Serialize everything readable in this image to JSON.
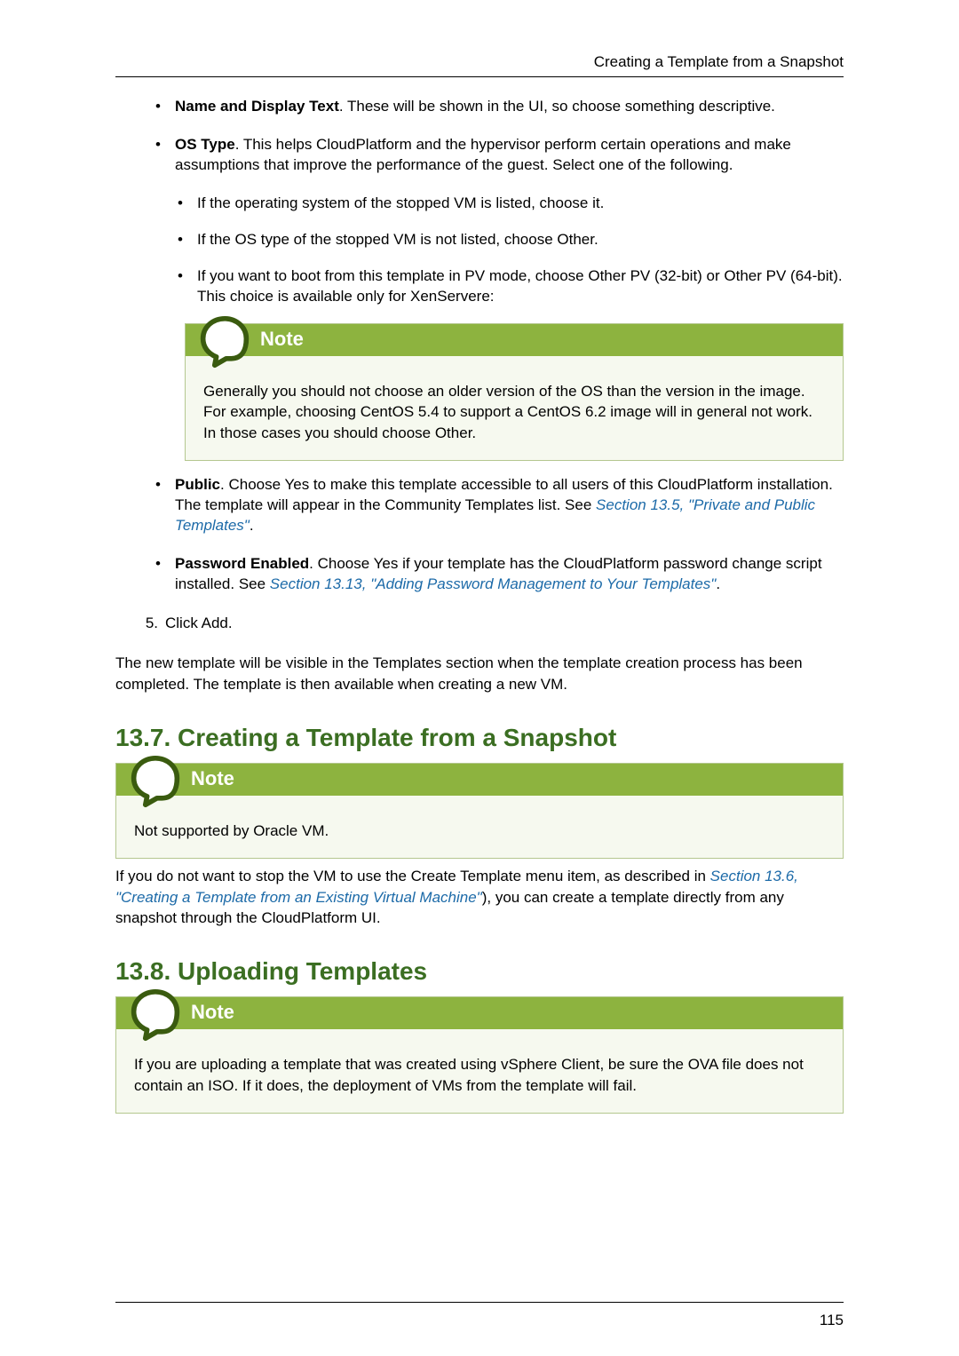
{
  "header": {
    "running_title": "Creating a Template from a Snapshot"
  },
  "bullets": {
    "name_display": {
      "label": "Name and Display Text",
      "text": ". These will be shown in the UI, so choose something descriptive."
    },
    "os_type": {
      "label": "OS Type",
      "text": ". This helps CloudPlatform and the hypervisor perform certain operations and make assumptions that improve the performance of the guest. Select one of the following."
    },
    "os_sub1": "If the operating system of the stopped VM is listed, choose it.",
    "os_sub2": "If the OS type of the stopped VM is not listed, choose Other.",
    "os_sub3": "If you want to boot from this template in PV mode, choose Other PV (32-bit) or Other PV (64-bit). This choice is available only for XenServere:",
    "public": {
      "label": "Public",
      "text1": ". Choose Yes to make this template accessible to all users of this CloudPlatform installation. The template will appear in the Community Templates list. See ",
      "link": "Section 13.5, \"Private and Public Templates\"",
      "text2": "."
    },
    "password_enabled": {
      "label": "Password Enabled",
      "text1": ". Choose Yes if your template has the CloudPlatform password change script installed. See ",
      "link": "Section 13.13, \"Adding Password Management to Your Templates\"",
      "text2": "."
    }
  },
  "note1": {
    "title": "Note",
    "body": "Generally you should not choose an older version of the OS than the version in the image. For example, choosing CentOS 5.4 to support a CentOS 6.2 image will in general not work. In those cases you should choose Other."
  },
  "step5": {
    "num": "5.",
    "text": "Click Add."
  },
  "after_steps_para": "The new template will be visible in the Templates section when the template creation process has been completed. The template is then available when creating a new VM.",
  "section137": {
    "heading": "13.7. Creating a Template from a Snapshot",
    "note_title": "Note",
    "note_body": "Not supported by Oracle VM.",
    "para1_a": "If you do not want to stop the VM to use the Create Template menu item, as described in ",
    "para1_link": "Section 13.6, \"Creating a Template from an Existing Virtual Machine\"",
    "para1_b": "), you can create a template directly from any snapshot through the CloudPlatform UI."
  },
  "section138": {
    "heading": "13.8. Uploading Templates",
    "note_title": "Note",
    "note_body": "If you are uploading a template that was created using vSphere Client, be sure the OVA file does not contain an ISO. If it does, the deployment of VMs from the template will fail."
  },
  "page_number": "115"
}
